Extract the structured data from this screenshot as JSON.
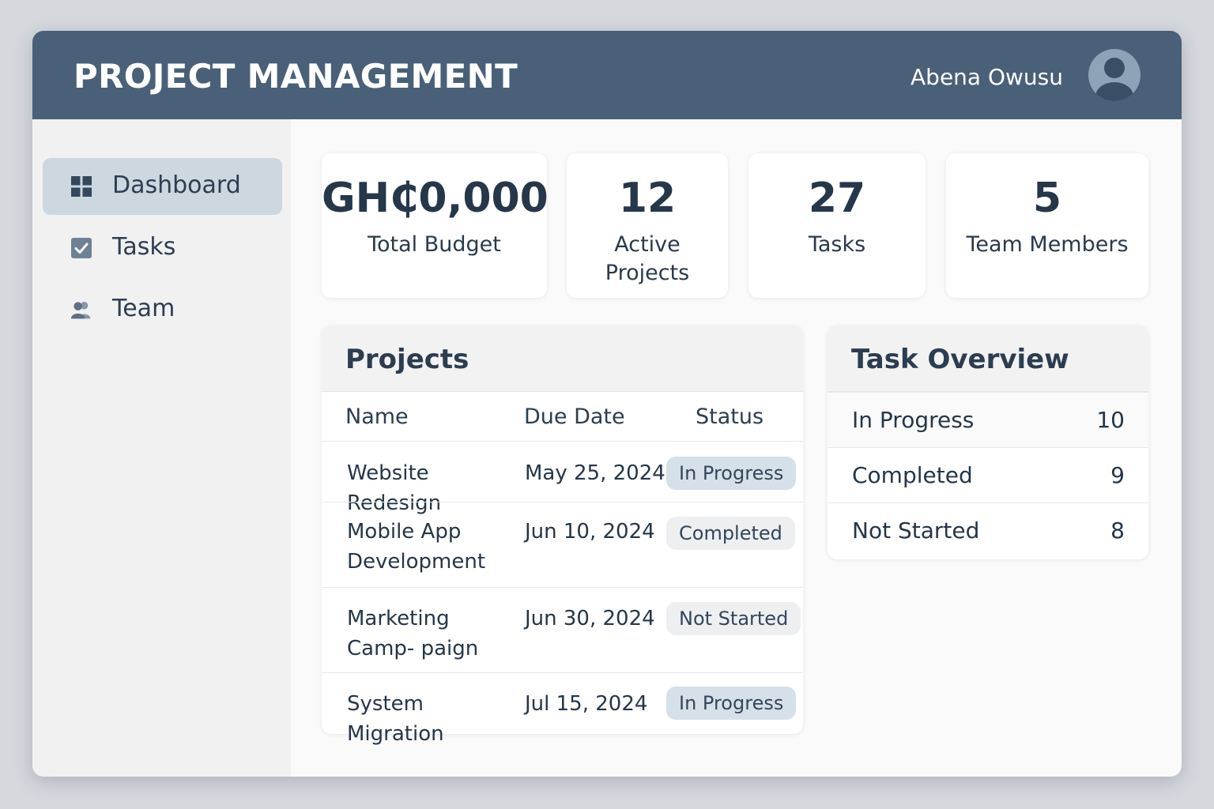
{
  "header": {
    "title": "PROJECT MANAGEMENT",
    "user_name": "Abena Owusu"
  },
  "sidebar": {
    "items": [
      {
        "label": "Dashboard",
        "icon": "grid-icon",
        "active": true
      },
      {
        "label": "Tasks",
        "icon": "checkbox-icon",
        "active": false
      },
      {
        "label": "Team",
        "icon": "people-icon",
        "active": false
      }
    ]
  },
  "stats": [
    {
      "value": "GH₵0,000",
      "label": "Total Budget"
    },
    {
      "value": "12",
      "label": "Active Projects"
    },
    {
      "value": "27",
      "label": "Tasks"
    },
    {
      "value": "5",
      "label": "Team Members"
    }
  ],
  "projects": {
    "title": "Projects",
    "columns": [
      "Name",
      "Due Date",
      "Status"
    ],
    "rows": [
      {
        "name": "Website Redesign",
        "due": "May 25, 2024",
        "status": "In Progress"
      },
      {
        "name": "Mobile App Development",
        "due": "Jun 10, 2024",
        "status": "Completed"
      },
      {
        "name": "Marketing Camp- paign",
        "due": "Jun 30, 2024",
        "status": "Not Started"
      },
      {
        "name": "System Migration",
        "due": "Jul 15, 2024",
        "status": "In Progress"
      }
    ]
  },
  "task_overview": {
    "title": "Task Overview",
    "items": [
      {
        "label": "In Progress",
        "count": "10"
      },
      {
        "label": "Completed",
        "count": "9"
      },
      {
        "label": "Not Started",
        "count": "8"
      }
    ]
  },
  "colors": {
    "header_bg": "#4a6078",
    "active_nav": "#cdd7e0",
    "badge_in_progress": "#d6e0e8",
    "badge_neutral": "#eeeff1"
  }
}
